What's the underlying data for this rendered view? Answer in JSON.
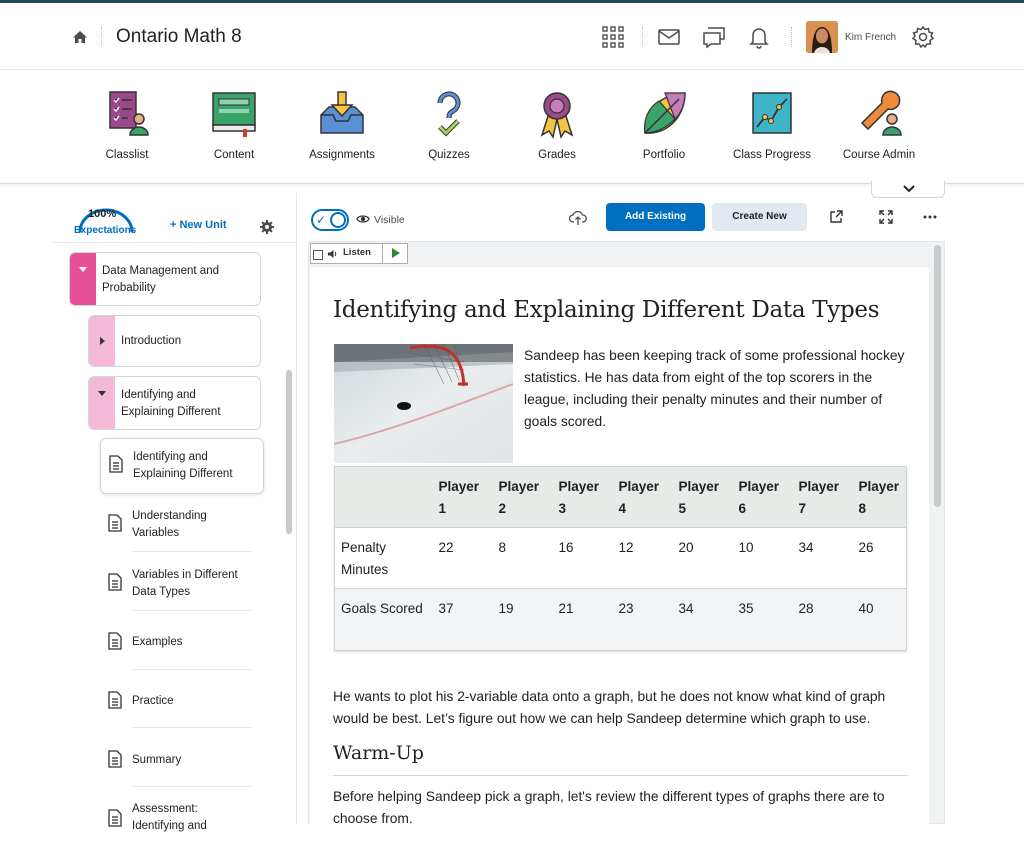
{
  "header": {
    "course_title": "Ontario Math 8",
    "username": "Kim French"
  },
  "tools": [
    {
      "label": "Classlist",
      "icon": "classlist-icon"
    },
    {
      "label": "Content",
      "icon": "content-icon"
    },
    {
      "label": "Assignments",
      "icon": "assignments-icon"
    },
    {
      "label": "Quizzes",
      "icon": "quizzes-icon"
    },
    {
      "label": "Grades",
      "icon": "grades-icon"
    },
    {
      "label": "Portfolio",
      "icon": "portfolio-icon"
    },
    {
      "label": "Class Progress",
      "icon": "class-progress-icon"
    },
    {
      "label": "Course Admin",
      "icon": "course-admin-icon"
    }
  ],
  "left_panel": {
    "progress_percent": "100%",
    "progress_label": "Expectations",
    "new_unit_label": "+ New Unit",
    "unit_title": "Data Management and Probability",
    "lessons": [
      {
        "title": "Introduction"
      },
      {
        "title": "Identifying and Explaining Different"
      }
    ],
    "topics": [
      {
        "title": "Identifying and Explaining Different"
      },
      {
        "title": "Understanding Variables"
      },
      {
        "title": "Variables in Different Data Types"
      },
      {
        "title": "Examples"
      },
      {
        "title": "Practice"
      },
      {
        "title": "Summary"
      },
      {
        "title": "Assessment: Identifying and"
      }
    ]
  },
  "content_toolbar": {
    "visibility_label": "Visible",
    "add_existing_label": "Add Existing",
    "create_new_label": "Create New",
    "listen_label": "Listen"
  },
  "page": {
    "title": "Identifying and Explaining Different Data Types",
    "intro": "Sandeep has been keeping track of some professional hockey statistics. He has data from eight of the top scorers in the league, including their penalty minutes and their number of goals scored.",
    "table": {
      "headers": [
        "",
        "Player 1",
        "Player 2",
        "Player 3",
        "Player 4",
        "Player 5",
        "Player 6",
        "Player 7",
        "Player 8"
      ],
      "rows": [
        {
          "label": "Penalty Minutes",
          "values": [
            "22",
            "8",
            "16",
            "12",
            "20",
            "10",
            "34",
            "26"
          ]
        },
        {
          "label": "Goals Scored",
          "values": [
            "37",
            "19",
            "21",
            "23",
            "34",
            "35",
            "28",
            "40"
          ]
        }
      ]
    },
    "paragraph2": "He wants to plot his 2-variable data onto a graph, but he does not know what kind of graph would be best.  Let’s figure out how we can help Sandeep determine which graph to use.",
    "warmup_heading": "Warm-Up",
    "paragraph3": "Before helping Sandeep pick a graph, let's review the different types of graphs there are to choose from."
  },
  "colors": {
    "accent": "#006fbf",
    "unit_tab": "#e8509a",
    "lesson_tab": "#f3b9d6",
    "header_stripe": "#1e4b5e"
  }
}
